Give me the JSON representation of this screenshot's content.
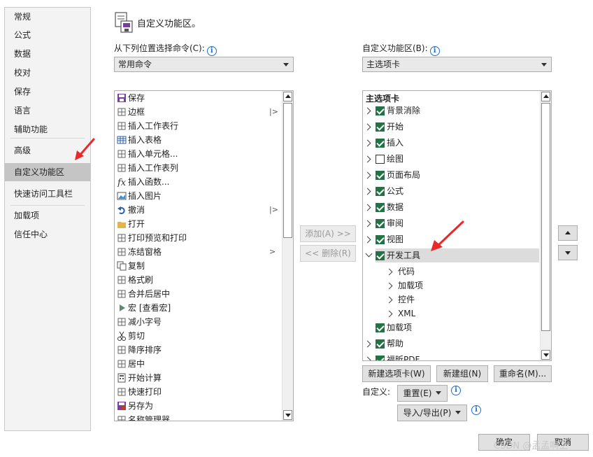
{
  "nav": {
    "items": [
      "常规",
      "公式",
      "数据",
      "校对",
      "保存",
      "语言",
      "辅助功能",
      "高级",
      "自定义功能区",
      "快速访问工具栏",
      "加载项",
      "信任中心"
    ],
    "selected": "自定义功能区"
  },
  "header": {
    "title": "自定义功能区。"
  },
  "left": {
    "label": "从下列位置选择命令(C):",
    "combo_value": "常用命令",
    "commands": [
      {
        "label": "保存",
        "icon": "save-icon"
      },
      {
        "label": "边框",
        "icon": "border-icon",
        "submenu": "|>"
      },
      {
        "label": "插入工作表行",
        "icon": "insert-row-icon"
      },
      {
        "label": "插入表格",
        "icon": "table-icon"
      },
      {
        "label": "插入单元格...",
        "icon": "insert-cell-icon"
      },
      {
        "label": "插入工作表列",
        "icon": "insert-column-icon"
      },
      {
        "label": "插入函数...",
        "icon": "function-icon"
      },
      {
        "label": "插入图片",
        "icon": "picture-icon"
      },
      {
        "label": "撤消",
        "icon": "undo-icon",
        "submenu": "|>"
      },
      {
        "label": "打开",
        "icon": "folder-icon"
      },
      {
        "label": "打印预览和打印",
        "icon": "print-preview-icon"
      },
      {
        "label": "冻结窗格",
        "icon": "freeze-panes-icon",
        "submenu": ">"
      },
      {
        "label": "复制",
        "icon": "copy-icon"
      },
      {
        "label": "格式刷",
        "icon": "format-painter-icon"
      },
      {
        "label": "合并后居中",
        "icon": "merge-center-icon"
      },
      {
        "label": "宏 [查看宏]",
        "icon": "macro-icon"
      },
      {
        "label": "减小字号",
        "icon": "decrease-font-icon"
      },
      {
        "label": "剪切",
        "icon": "cut-icon"
      },
      {
        "label": "降序排序",
        "icon": "sort-desc-icon"
      },
      {
        "label": "居中",
        "icon": "align-center-icon"
      },
      {
        "label": "开始计算",
        "icon": "calculator-icon"
      },
      {
        "label": "快速打印",
        "icon": "quick-print-icon"
      },
      {
        "label": "另存为",
        "icon": "save-as-icon"
      },
      {
        "label": "名称管理器",
        "icon": "name-manager-icon"
      }
    ]
  },
  "middle": {
    "add_label": "添加(A) >>",
    "remove_label": "<< 删除(R)"
  },
  "right": {
    "label": "自定义功能区(B):",
    "combo_value": "主选项卡",
    "tree_title": "主选项卡",
    "tabs": [
      {
        "label": "背景消除",
        "checked": true
      },
      {
        "label": "开始",
        "checked": true
      },
      {
        "label": "插入",
        "checked": true
      },
      {
        "label": "绘图",
        "checked": false
      },
      {
        "label": "页面布局",
        "checked": true
      },
      {
        "label": "公式",
        "checked": true
      },
      {
        "label": "数据",
        "checked": true
      },
      {
        "label": "审阅",
        "checked": true
      },
      {
        "label": "视图",
        "checked": true
      },
      {
        "label": "开发工具",
        "checked": true,
        "expanded": true
      },
      {
        "label": "代码",
        "child": true
      },
      {
        "label": "加载项",
        "child": true
      },
      {
        "label": "控件",
        "child": true
      },
      {
        "label": "XML",
        "child": true
      },
      {
        "label": "加载项",
        "checked": true,
        "no_chevron": true
      },
      {
        "label": "帮助",
        "checked": true
      },
      {
        "label": "福昕PDF",
        "checked": true
      }
    ],
    "new_tab_label": "新建选项卡(W)",
    "new_group_label": "新建组(N)",
    "rename_label": "重命名(M)...",
    "customize_label": "自定义:",
    "reset_label": "重置(E)",
    "import_export_label": "导入/导出(P)"
  },
  "footer": {
    "ok_label": "确定",
    "cancel_label": "取消",
    "watermark": "CSDN @孟孟啊上"
  },
  "colors": {
    "accent_red": "#e8282b",
    "check_green": "#217346",
    "info_blue": "#1f6fc5"
  }
}
